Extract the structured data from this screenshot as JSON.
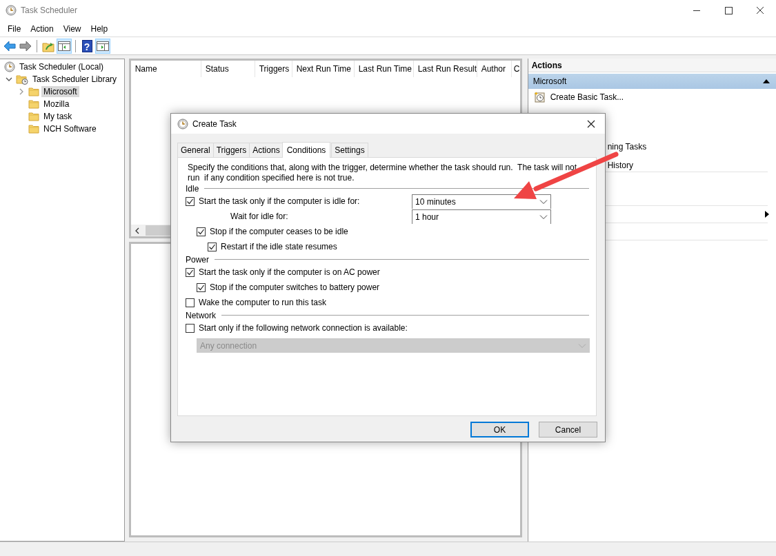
{
  "window": {
    "title": "Task Scheduler"
  },
  "menu": [
    "File",
    "Action",
    "View",
    "Help"
  ],
  "toolbar": [
    {
      "kind": "back"
    },
    {
      "kind": "forward"
    },
    {
      "kind": "separator"
    },
    {
      "kind": "up"
    },
    {
      "kind": "pane-left",
      "selected": true
    },
    {
      "kind": "separator"
    },
    {
      "kind": "help",
      "glyph": "?"
    },
    {
      "kind": "pane-right",
      "selected": true
    }
  ],
  "tree": [
    {
      "label": "Task Scheduler (Local)",
      "kind": "clock",
      "children": [
        {
          "label": "Task Scheduler Library",
          "kind": "library",
          "expanded": true,
          "children": [
            {
              "label": "Microsoft",
              "kind": "folder",
              "selected": true,
              "expanded": false
            },
            {
              "label": "Mozilla",
              "kind": "folder",
              "selected": false
            },
            {
              "label": "My task",
              "kind": "folder",
              "selected": false
            },
            {
              "label": "NCH Software",
              "kind": "folder",
              "selected": false
            }
          ]
        }
      ]
    }
  ],
  "table": {
    "columns": [
      "Name",
      "Status",
      "Triggers",
      "Next Run Time",
      "Last Run Time",
      "Last Run Result",
      "Author",
      "C"
    ]
  },
  "actions": {
    "title": "Actions",
    "section": {
      "title": "Microsoft",
      "expanded": true
    },
    "items": [
      {
        "kind": "create",
        "label": "Create Basic Task..."
      },
      {
        "kind": "covered"
      },
      {
        "kind": "covered"
      },
      {
        "kind": "clipped",
        "label": "ning Tasks"
      },
      {
        "kind": "clipped",
        "label": "History"
      },
      {
        "kind": "separator"
      },
      {
        "kind": "covered"
      },
      {
        "kind": "covered"
      },
      {
        "kind": "separator"
      },
      {
        "kind": "submenu"
      },
      {
        "kind": "separator"
      },
      {
        "kind": "covered"
      },
      {
        "kind": "separator"
      }
    ]
  },
  "dialog": {
    "title": "Create Task",
    "tabs": [
      {
        "label": "General",
        "selected": false
      },
      {
        "label": "Triggers",
        "selected": false
      },
      {
        "label": "Actions",
        "selected": false
      },
      {
        "label": "Conditions",
        "selected": true
      },
      {
        "label": "Settings",
        "selected": false
      }
    ],
    "description": "Specify the conditions that, along with the trigger, determine whether the task should run.  The task will not run  if any condition specified here is not true.",
    "sections": [
      {
        "title": "Idle",
        "items": [
          {
            "kind": "checkbox",
            "label": "Start the task only if the computer is idle for:",
            "checked": true,
            "value": "10 minutes",
            "children": [
              {
                "kind": "dropdown",
                "label": "Wait for idle for:",
                "value": "1 hour"
              },
              {
                "kind": "checkbox",
                "label": "Stop if the computer ceases to be idle",
                "checked": true,
                "children": [
                  {
                    "kind": "checkbox",
                    "label": "Restart if the idle state resumes",
                    "checked": true
                  }
                ]
              }
            ]
          }
        ]
      },
      {
        "title": "Power",
        "items": [
          {
            "kind": "checkbox",
            "label": "Start the task only if the computer is on AC power",
            "checked": true,
            "children": [
              {
                "kind": "checkbox",
                "label": "Stop if the computer switches to battery power",
                "checked": true
              }
            ]
          },
          {
            "kind": "checkbox",
            "label": "Wake the computer to run this task",
            "checked": false
          }
        ]
      },
      {
        "title": "Network",
        "items": [
          {
            "kind": "checkbox",
            "label": "Start only if the following network connection is available:",
            "checked": false,
            "children": [
              {
                "kind": "dropdown",
                "value": "Any connection",
                "disabled": true
              }
            ]
          }
        ]
      }
    ],
    "buttons": [
      {
        "label": "OK",
        "default": true
      },
      {
        "label": "Cancel",
        "default": false
      }
    ]
  }
}
